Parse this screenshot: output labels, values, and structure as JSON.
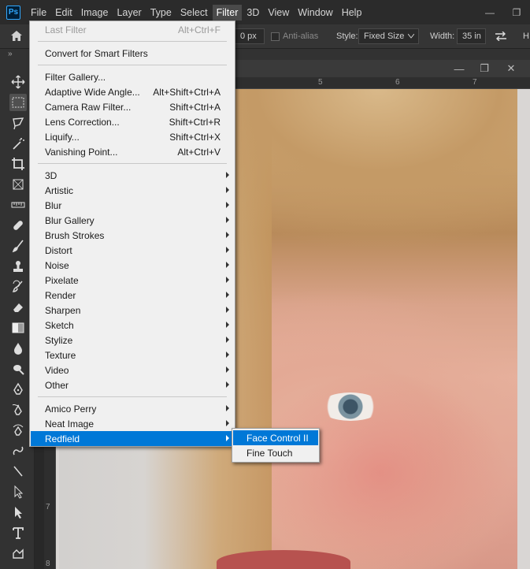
{
  "app": {
    "logo": "Ps"
  },
  "menubar": [
    "File",
    "Edit",
    "Image",
    "Layer",
    "Type",
    "Select",
    "Filter",
    "3D",
    "View",
    "Window",
    "Help"
  ],
  "menubar_active": "Filter",
  "window_controls": {
    "minimize": "—",
    "restore": "❐"
  },
  "options": {
    "feather_value": "0 px",
    "antialias_label": "Anti-alias",
    "style_label": "Style:",
    "style_value": "Fixed Size",
    "width_label": "Width:",
    "width_value": "35 in",
    "height_label": "H"
  },
  "doc_controls": {
    "minimize": "—",
    "restore": "❐",
    "close": "✕"
  },
  "ruler_ticks": {
    "h": [
      "5",
      "6",
      "7"
    ],
    "v": [
      "7",
      "8"
    ]
  },
  "filter_menu": {
    "last_filter": {
      "label": "Last Filter",
      "shortcut": "Alt+Ctrl+F"
    },
    "smart_filters": "Convert for Smart Filters",
    "group1": [
      {
        "label": "Filter Gallery...",
        "shortcut": ""
      },
      {
        "label": "Adaptive Wide Angle...",
        "shortcut": "Alt+Shift+Ctrl+A"
      },
      {
        "label": "Camera Raw Filter...",
        "shortcut": "Shift+Ctrl+A"
      },
      {
        "label": "Lens Correction...",
        "shortcut": "Shift+Ctrl+R"
      },
      {
        "label": "Liquify...",
        "shortcut": "Shift+Ctrl+X"
      },
      {
        "label": "Vanishing Point...",
        "shortcut": "Alt+Ctrl+V"
      }
    ],
    "group2": [
      "3D",
      "Artistic",
      "Blur",
      "Blur Gallery",
      "Brush Strokes",
      "Distort",
      "Noise",
      "Pixelate",
      "Render",
      "Sharpen",
      "Sketch",
      "Stylize",
      "Texture",
      "Video",
      "Other"
    ],
    "group3": [
      "Amico Perry",
      "Neat Image",
      "Redfield"
    ],
    "highlighted": "Redfield"
  },
  "submenu": {
    "items": [
      "Face Control II",
      "Fine Touch"
    ],
    "highlighted": "Face Control II"
  },
  "colors": {
    "highlight": "#0078d7",
    "menu_bg": "#f0f0f0",
    "ui_dark": "#323232"
  }
}
